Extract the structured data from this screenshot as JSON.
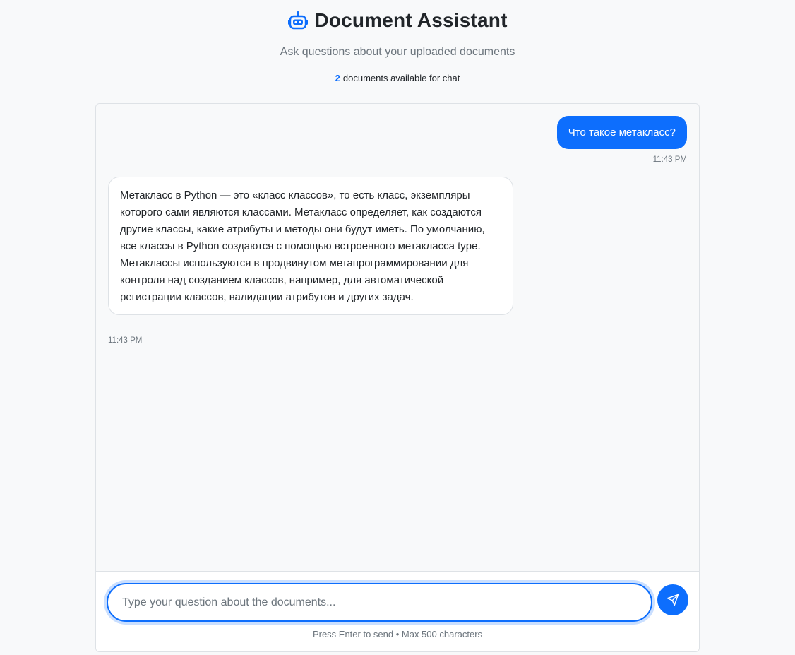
{
  "header": {
    "title": "Document Assistant",
    "subtitle": "Ask questions about your uploaded documents",
    "doc_count": "2",
    "doc_count_suffix": "documents available for chat",
    "icon": "robot-icon"
  },
  "messages": [
    {
      "role": "user",
      "text": "Что такое метакласс?",
      "time": "11:43 PM"
    },
    {
      "role": "assistant",
      "text": "Метакласс в Python — это «класс классов», то есть класс, экземпляры которого сами являются классами. Метакласс определяет, как создаются другие классы, какие атрибуты и методы они будут иметь. По умолчанию, все классы в Python создаются с помощью встроенного метакласса type. Метаклассы используются в продвинутом метапрограммировании для контроля над созданием классов, например, для автоматической регистрации классов, валидации атрибутов и других задач.",
      "time": "11:43 PM"
    }
  ],
  "composer": {
    "placeholder": "Type your question about the documents...",
    "value": "",
    "send_icon": "send-icon",
    "hint": "Press Enter to send • Max 500 characters"
  },
  "colors": {
    "accent": "#0d6efd",
    "background": "#f8f9fa",
    "muted": "#6c757d"
  }
}
